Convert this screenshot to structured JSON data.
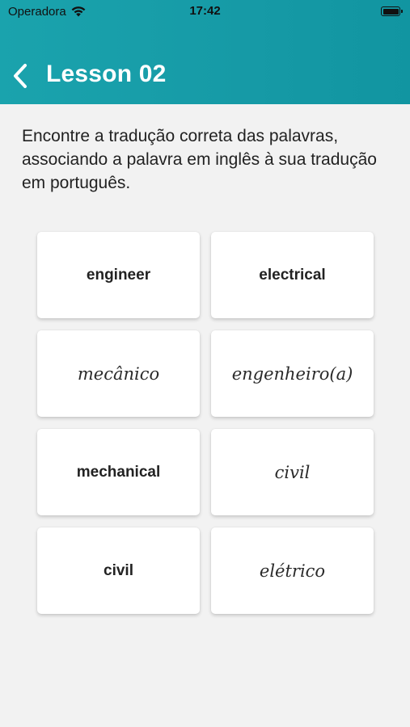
{
  "status_bar": {
    "carrier": "Operadora",
    "time": "17:42"
  },
  "nav": {
    "title": "Lesson 02",
    "back_icon": "chevron-left-icon"
  },
  "instructions": "Encontre a tradução correta das palavras, associando a palavra em inglês à sua tradução em português.",
  "cards": [
    {
      "text": "engineer",
      "lang": "en"
    },
    {
      "text": "electrical",
      "lang": "en"
    },
    {
      "text": "mecânico",
      "lang": "pt"
    },
    {
      "text": "engenheiro(a)",
      "lang": "pt"
    },
    {
      "text": "mechanical",
      "lang": "en"
    },
    {
      "text": "civil",
      "lang": "pt"
    },
    {
      "text": "civil",
      "lang": "en"
    },
    {
      "text": "elétrico",
      "lang": "pt"
    }
  ],
  "colors": {
    "header": "#1aa3ad",
    "background": "#f2f2f2",
    "card": "#ffffff",
    "title_text": "#ffffff"
  }
}
